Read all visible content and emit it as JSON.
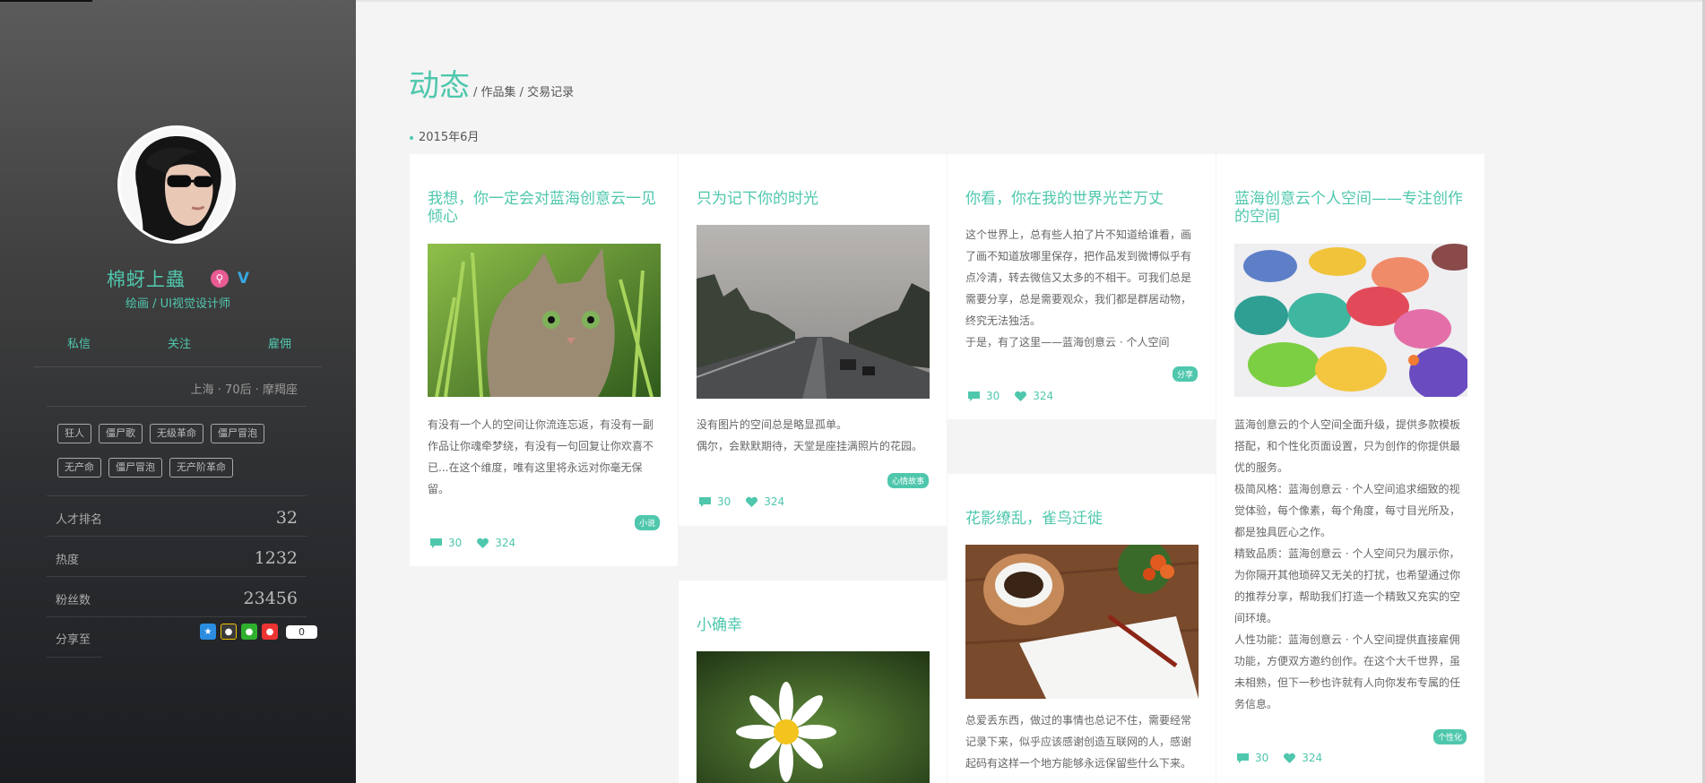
{
  "profile": {
    "name": "棉蚜上蟲",
    "subtitle": "绘画 / UI视觉设计师",
    "badge_v": "V",
    "actions": [
      "私信",
      "关注",
      "雇佣"
    ],
    "location": "上海 · 70后 · 摩羯座",
    "tags": [
      "狂人",
      "僵尸歌",
      "无级革命",
      "僵尸冒泡",
      "无产命",
      "僵尸冒泡",
      "无产阶革命"
    ],
    "stats": [
      {
        "label": "人才排名",
        "value": "32"
      },
      {
        "label": "热度",
        "value": "1232"
      },
      {
        "label": "粉丝数",
        "value": "23456"
      }
    ],
    "share_label": "分享至",
    "share_count": "0"
  },
  "main": {
    "heading": "动态",
    "sub_nav": "/ 作品集 / 交易记录",
    "date": "2015年6月"
  },
  "cards": [
    {
      "title": "我想，你一定会对蓝海创意云一见倾心",
      "image_icon": "kitten-photo",
      "paragraphs": [
        "有没有一个人的空间让你流连忘返，有没有一副作品让你魂牵梦绕，有没有一句回复让你欢喜不已...在这个维度，唯有这里将永远对你毫无保留。"
      ],
      "label": "小说",
      "comments": "30",
      "likes": "324"
    },
    {
      "title": "只为记下你的时光",
      "image_icon": "foggy-road-photo",
      "paragraphs": [
        "没有图片的空间总是略显孤单。",
        "偶尔，会默默期待，天堂是座挂满照片的花园。"
      ],
      "label": "心情故事",
      "comments": "30",
      "likes": "324"
    },
    {
      "title": "你看，你在我的世界光芒万丈",
      "paragraphs": [
        "这个世界上，总有些人拍了片不知道给谁看，画了画不知道放哪里保存，把作品发到微博似乎有点冷清，转去微信又太多的不相干。可我们总是需要分享，总是需要观众，我们都是群居动物，终究无法独活。",
        "于是，有了这里——蓝海创意云 · 个人空间"
      ],
      "label": "分享",
      "comments": "30",
      "likes": "324"
    },
    {
      "title": "蓝海创意云个人空间——专注创作的空间",
      "image_icon": "paint-palette-photo",
      "paragraphs": [
        "蓝海创意云的个人空间全面升级，提供多款模板搭配，和个性化页面设置，只为创作的你提供最优的服务。",
        "极简风格：蓝海创意云 · 个人空间追求细致的视觉体验，每个像素，每个角度，每寸目光所及，都是独具匠心之作。",
        "精致品质：蓝海创意云 · 个人空间只为展示你，为你隔开其他琐碎又无关的打扰，也希望通过你的推荐分享，帮助我们打造一个精致又充实的空间环境。",
        "人性功能：蓝海创意云 · 个人空间提供直接雇佣功能，方便双方邀约创作。在这个大千世界，虽未相熟，但下一秒也许就有人向你发布专属的任务信息。"
      ],
      "label": "个性化",
      "comments": "30",
      "likes": "324"
    },
    {
      "title": "小确幸",
      "image_icon": "daisy-photo"
    },
    {
      "title": "花影缭乱，雀鸟迁徙",
      "image_icon": "coffee-notebook-photo",
      "paragraphs": [
        "总爱丢东西，做过的事情也总记不住，需要经常记录下来，似乎应该感谢创造互联网的人，感谢起码有这样一个地方能够永远保留些什么下来。"
      ]
    }
  ],
  "colors": {
    "accent": "#4fc7ad",
    "sidebar_top": "#5b5b5b",
    "sidebar_bottom": "#1b1d20",
    "badge_pink": "#e85b93",
    "badge_blue": "#36a8e0"
  },
  "icons": {
    "comment": "comment-bubble-icon",
    "like": "heart-icon",
    "share": [
      "qzone-icon",
      "qq-icon",
      "wechat-icon",
      "weibo-icon"
    ]
  }
}
